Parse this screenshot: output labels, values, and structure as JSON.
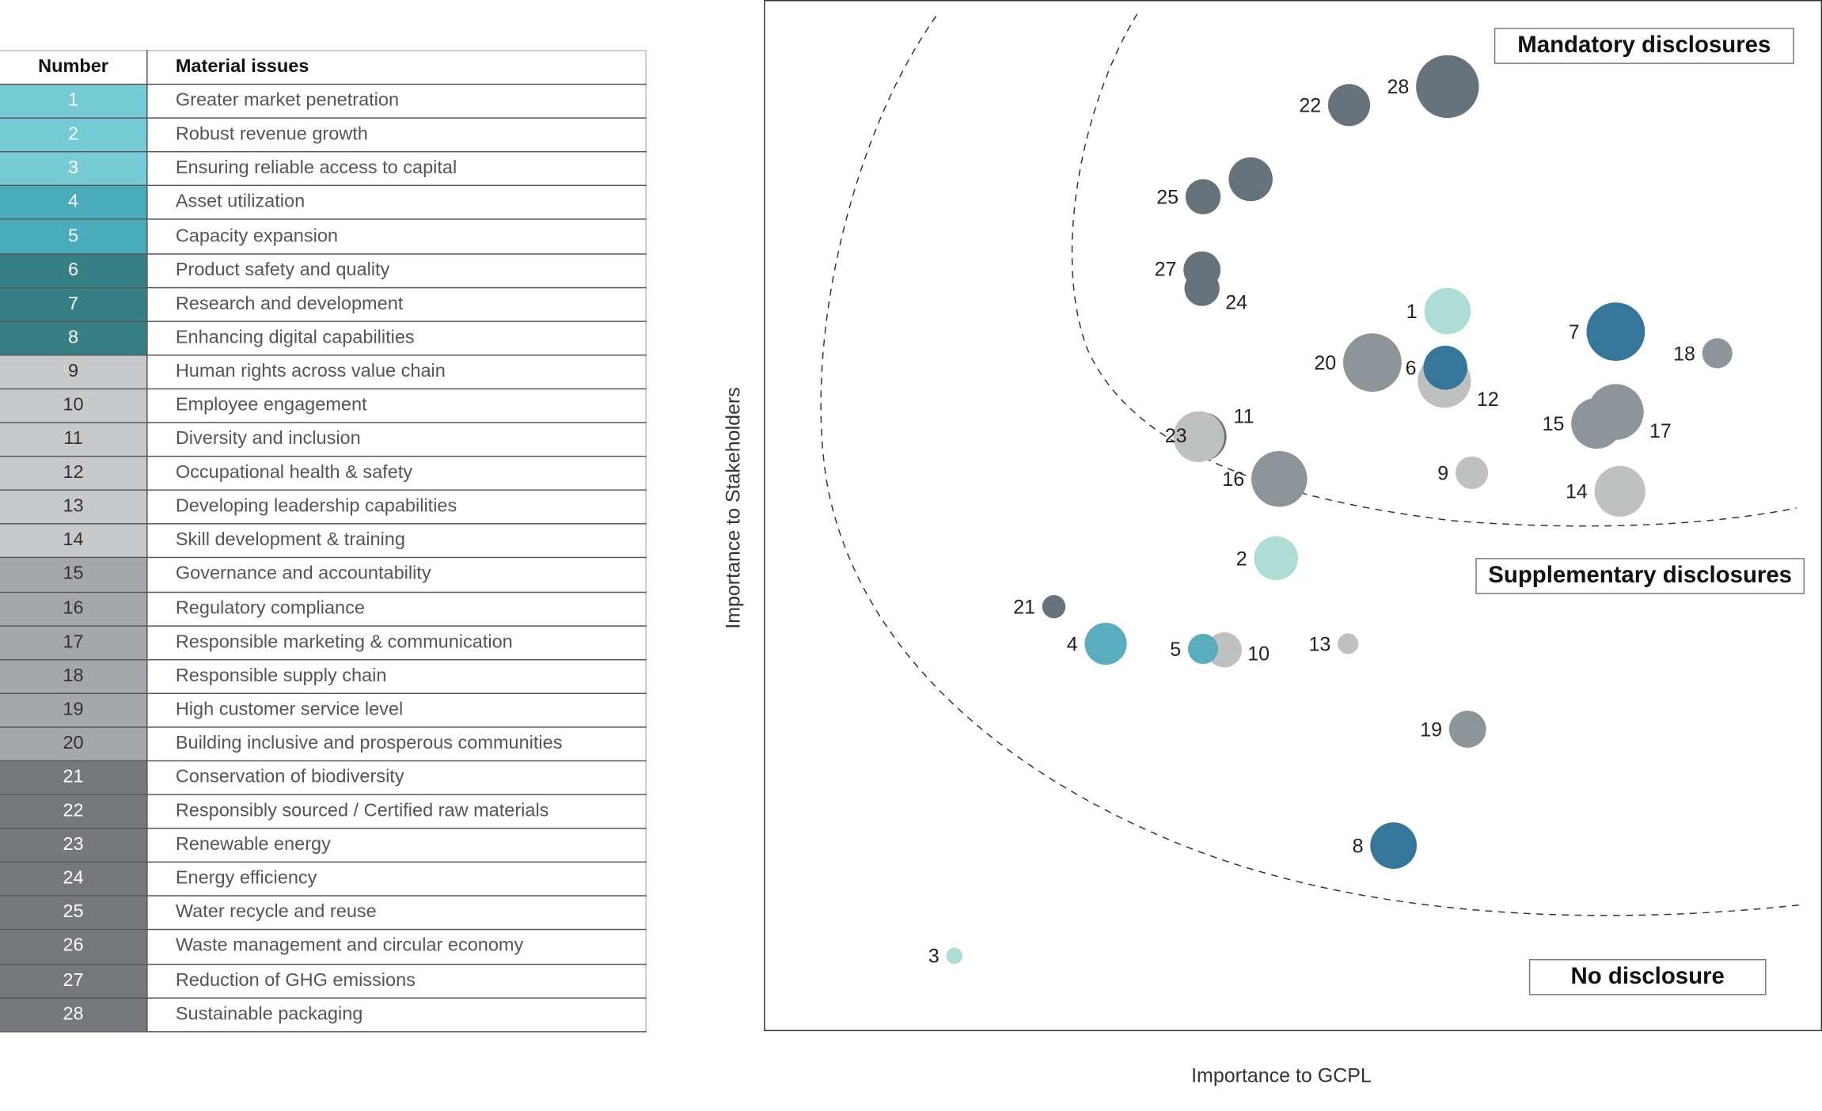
{
  "table": {
    "headers": {
      "number": "Number",
      "issue": "Material issues"
    },
    "rows": [
      {
        "n": "1",
        "issue": "Greater market penetration"
      },
      {
        "n": "2",
        "issue": "Robust revenue growth"
      },
      {
        "n": "3",
        "issue": "Ensuring reliable access to capital"
      },
      {
        "n": "4",
        "issue": "Asset utilization"
      },
      {
        "n": "5",
        "issue": "Capacity expansion"
      },
      {
        "n": "6",
        "issue": "Product safety and quality"
      },
      {
        "n": "7",
        "issue": "Research and development"
      },
      {
        "n": "8",
        "issue": "Enhancing digital capabilities"
      },
      {
        "n": "9",
        "issue": "Human rights across value chain"
      },
      {
        "n": "10",
        "issue": "Employee engagement"
      },
      {
        "n": "11",
        "issue": "Diversity and inclusion"
      },
      {
        "n": "12",
        "issue": "Occupational health & safety"
      },
      {
        "n": "13",
        "issue": "Developing leadership capabilities"
      },
      {
        "n": "14",
        "issue": "Skill development & training"
      },
      {
        "n": "15",
        "issue": "Governance and accountability"
      },
      {
        "n": "16",
        "issue": "Regulatory compliance"
      },
      {
        "n": "17",
        "issue": "Responsible marketing & communication"
      },
      {
        "n": "18",
        "issue": "Responsible supply chain"
      },
      {
        "n": "19",
        "issue": "High customer service level"
      },
      {
        "n": "20",
        "issue": "Building inclusive and prosperous communities"
      },
      {
        "n": "21",
        "issue": "Conservation of biodiversity"
      },
      {
        "n": "22",
        "issue": "Responsibly sourced / Certified raw materials"
      },
      {
        "n": "23",
        "issue": "Renewable energy"
      },
      {
        "n": "24",
        "issue": "Energy efficiency"
      },
      {
        "n": "25",
        "issue": "Water recycle and reuse"
      },
      {
        "n": "26",
        "issue": "Waste management and circular economy"
      },
      {
        "n": "27",
        "issue": "Reduction of GHG emissions"
      },
      {
        "n": "28",
        "issue": "Sustainable packaging"
      }
    ]
  },
  "group_colors": {
    "1-3": {
      "table": "#76cbd4",
      "bubble": "#aedcd6",
      "text": "#ffffff"
    },
    "4-5": {
      "table": "#4aabbb",
      "bubble": "#5aacbf",
      "text": "#ffffff"
    },
    "6-8": {
      "table": "#367f84",
      "bubble": "#35769a",
      "text": "#ffffff"
    },
    "9-14": {
      "table": "#c8c9cb",
      "bubble": "#bfc0c0",
      "text": "#333333"
    },
    "15-20": {
      "table": "#a5a7aa",
      "bubble": "#8c9698",
      "text": "#333333"
    },
    "21-28": {
      "table": "#76787c",
      "bubble": "#66737c",
      "text": "#ffffff"
    }
  },
  "chart_data": {
    "type": "scatter",
    "subtype": "bubble",
    "xlabel": "Importance to GCPL",
    "ylabel": "Importance to Stakeholders",
    "xlim": [
      0,
      10
    ],
    "ylim": [
      0,
      10
    ],
    "grid": false,
    "regions": [
      "Mandatory disclosures",
      "Supplementary disclosures",
      "No disclosure"
    ],
    "points": [
      {
        "id": "1",
        "x": 6.46,
        "y": 6.98,
        "size": 7.4
      },
      {
        "id": "2",
        "x": 4.84,
        "y": 4.58,
        "size": 7.0
      },
      {
        "id": "3",
        "x": 1.8,
        "y": 0.72,
        "size": 2.6
      },
      {
        "id": "4",
        "x": 3.23,
        "y": 3.75,
        "size": 6.7
      },
      {
        "id": "5",
        "x": 4.15,
        "y": 3.7,
        "size": 4.8
      },
      {
        "id": "6",
        "x": 6.44,
        "y": 6.43,
        "size": 7.0
      },
      {
        "id": "7",
        "x": 8.05,
        "y": 6.78,
        "size": 9.3
      },
      {
        "id": "8",
        "x": 5.95,
        "y": 1.79,
        "size": 7.4
      },
      {
        "id": "9",
        "x": 6.69,
        "y": 5.41,
        "size": 5.2
      },
      {
        "id": "10",
        "x": 4.35,
        "y": 3.69,
        "size": 5.6
      },
      {
        "id": "11",
        "x": 4.11,
        "y": 5.76,
        "size": 8.1
      },
      {
        "id": "12",
        "x": 6.43,
        "y": 6.3,
        "size": 8.5
      },
      {
        "id": "13",
        "x": 5.52,
        "y": 3.75,
        "size": 3.3
      },
      {
        "id": "14",
        "x": 8.09,
        "y": 5.23,
        "size": 8.1
      },
      {
        "id": "15",
        "x": 7.87,
        "y": 5.89,
        "size": 8.1
      },
      {
        "id": "16",
        "x": 4.87,
        "y": 5.35,
        "size": 8.9
      },
      {
        "id": "17",
        "x": 8.05,
        "y": 6.0,
        "size": 8.9
      },
      {
        "id": "18",
        "x": 9.01,
        "y": 6.57,
        "size": 4.8
      },
      {
        "id": "19",
        "x": 6.65,
        "y": 2.92,
        "size": 5.9
      },
      {
        "id": "20",
        "x": 5.75,
        "y": 6.48,
        "size": 9.3
      },
      {
        "id": "21",
        "x": 2.74,
        "y": 4.11,
        "size": 3.7
      },
      {
        "id": "22",
        "x": 5.53,
        "y": 8.98,
        "size": 6.7
      },
      {
        "id": "23",
        "x": 4.14,
        "y": 5.76,
        "size": 7.8
      },
      {
        "id": "24",
        "x": 4.14,
        "y": 7.2,
        "size": 5.6
      },
      {
        "id": "25",
        "x": 4.15,
        "y": 8.09,
        "size": 5.6
      },
      {
        "id": "26",
        "x": 4.6,
        "y": 8.26,
        "size": 7.0
      },
      {
        "id": "27",
        "x": 4.14,
        "y": 7.38,
        "size": 5.9
      },
      {
        "id": "28",
        "x": 6.46,
        "y": 9.16,
        "size": 10.0
      }
    ]
  }
}
